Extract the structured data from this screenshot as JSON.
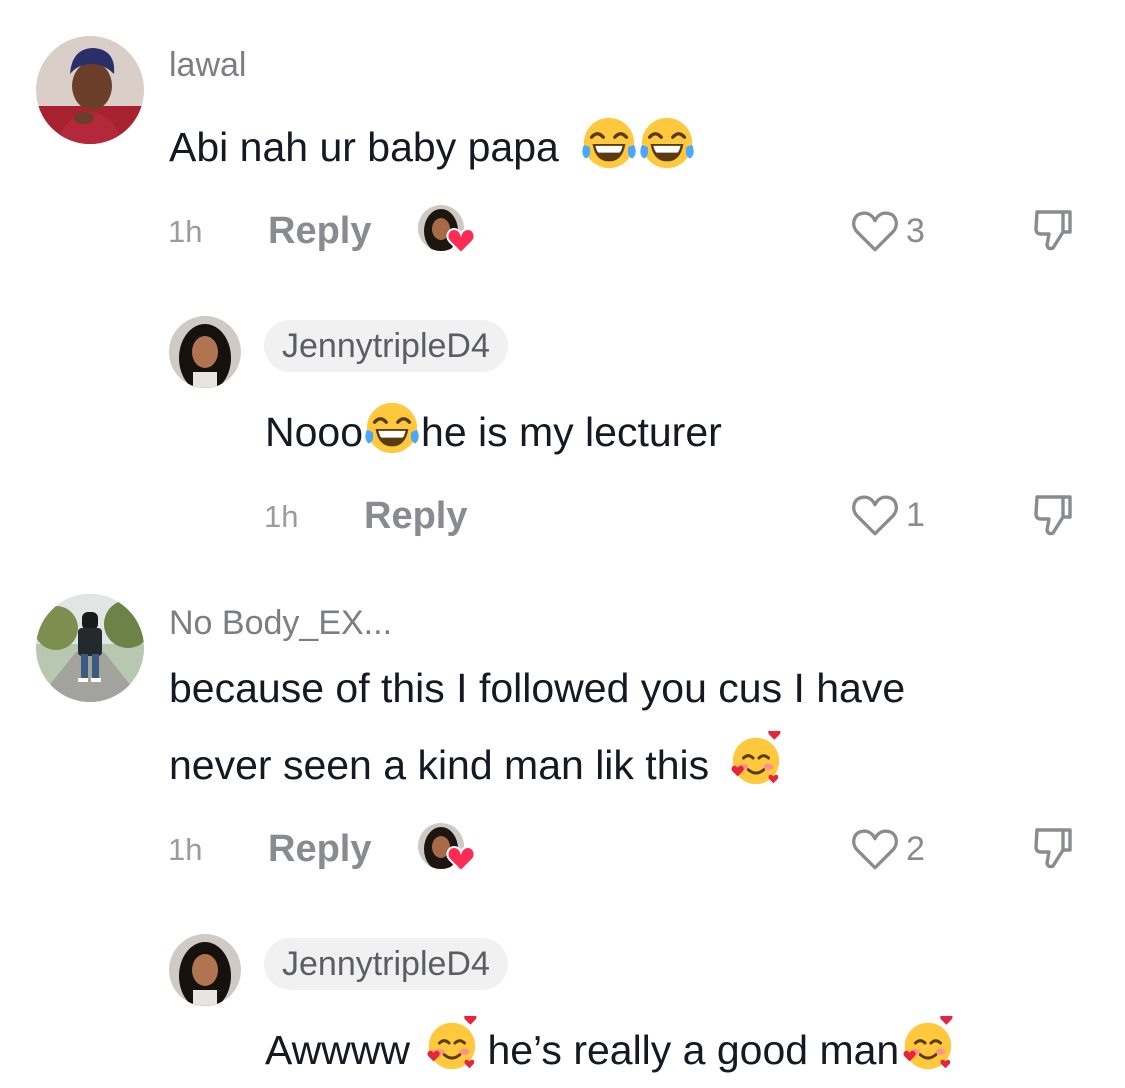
{
  "comments": [
    {
      "username": "lawal",
      "text": "Abi nah ur baby papa",
      "emojis": [
        "tears-of-joy-emoji",
        "tears-of-joy-emoji"
      ],
      "time": "1h",
      "reply_label": "Reply",
      "creator_liked": true,
      "likes": "3"
    },
    {
      "username": "JennytripleD4",
      "is_creator_reply": true,
      "text_before": "Nooo",
      "emoji": "tears-of-joy-emoji",
      "text_after": "he is my lecturer",
      "time": "1h",
      "reply_label": "Reply",
      "likes": "1"
    },
    {
      "username": "No Body_EX...",
      "text_line1": "because of this I followed you cus I have",
      "text_line2": "never seen a kind man lik this",
      "emoji": "smiling-face-with-hearts-emoji",
      "time": "1h",
      "reply_label": "Reply",
      "creator_liked": true,
      "likes": "2"
    },
    {
      "username": "JennytripleD4",
      "is_creator_reply": true,
      "text_before": "Awwww",
      "text_middle": "he’s really a good man",
      "emoji": "smiling-face-with-hearts-emoji"
    }
  ],
  "colors": {
    "text": "#161823",
    "secondary": "#8a8b91",
    "pill_bg": "#f1f1f2",
    "heart_badge": "#fe2c55"
  }
}
